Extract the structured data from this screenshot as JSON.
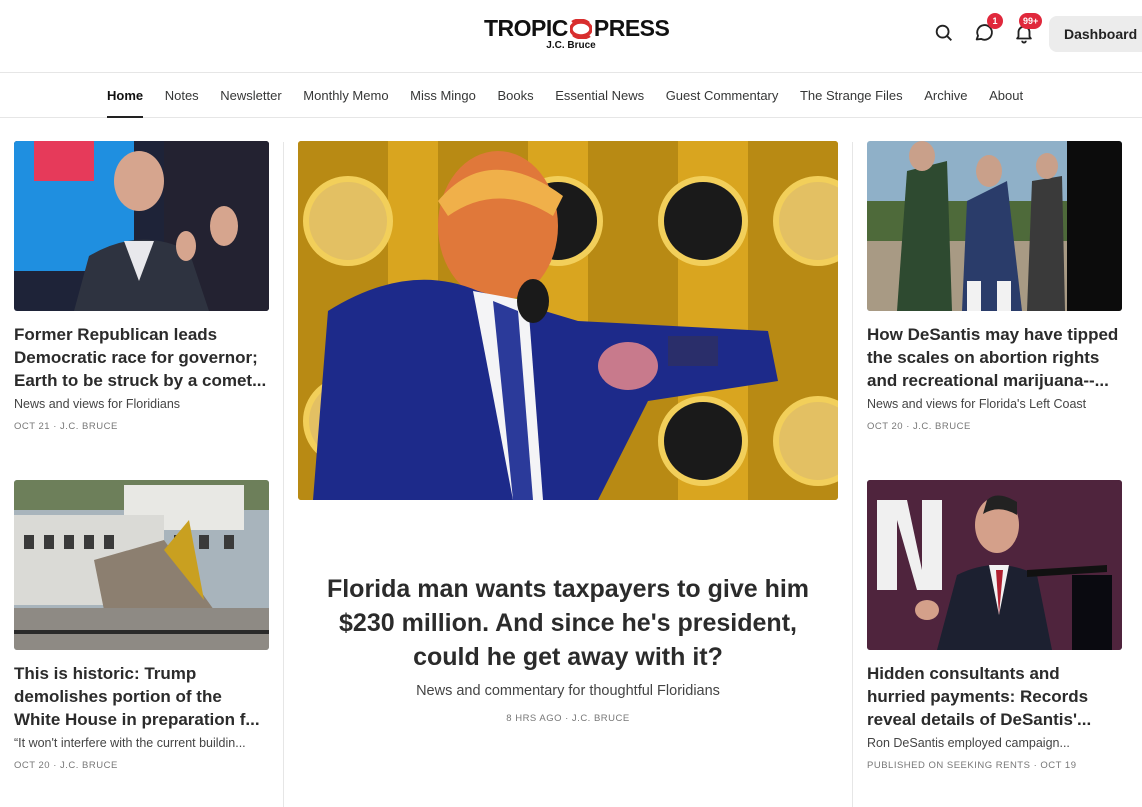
{
  "brand": {
    "name_left": "TROPIC",
    "name_right": "PRESS",
    "author": "J.C. Bruce"
  },
  "header": {
    "search_icon": "search-icon",
    "chat_icon": "chat-bubble-icon",
    "chat_badge": "1",
    "bell_icon": "bell-icon",
    "bell_badge": "99+",
    "dashboard_label": "Dashboard"
  },
  "nav": {
    "items": [
      {
        "label": "Home",
        "active": true
      },
      {
        "label": "Notes"
      },
      {
        "label": "Newsletter"
      },
      {
        "label": "Monthly Memo"
      },
      {
        "label": "Miss Mingo"
      },
      {
        "label": "Books"
      },
      {
        "label": "Essential News"
      },
      {
        "label": "Guest Commentary"
      },
      {
        "label": "The Strange Files"
      },
      {
        "label": "Archive"
      },
      {
        "label": "About"
      }
    ]
  },
  "posts": {
    "left_top": {
      "title": "Former Republican leads Democratic race for governor; Earth to be struck by a comet...",
      "subtitle": "News and views for Floridians",
      "meta": "OCT 21 · J.C. BRUCE"
    },
    "left_bottom": {
      "title": "This is historic: Trump demolishes portion of the White House in preparation f...",
      "subtitle": "“It won't interfere with the current buildin...",
      "meta": "OCT 20 · J.C. BRUCE"
    },
    "featured": {
      "title": "Florida man wants taxpayers to give him $230 million. And since he's president, could he get away with it?",
      "subtitle": "News and commentary for thoughtful Floridians",
      "meta": "8 HRS AGO · J.C. BRUCE"
    },
    "right_top": {
      "title": "How DeSantis may have tipped the scales on abortion rights and recreational marijuana--...",
      "subtitle": "News and views for Florida's Left Coast",
      "meta": "OCT 20 · J.C. BRUCE"
    },
    "right_bottom": {
      "title": "Hidden consultants and hurried payments: Records reveal details of DeSantis'...",
      "subtitle": "Ron DeSantis employed campaign...",
      "meta": "PUBLISHED ON SEEKING RENTS · OCT 19"
    }
  },
  "colors": {
    "accent_red": "#e0283c",
    "logo_mark": "#d82e2e",
    "gold": "#d9a51f",
    "navy": "#1d2a8a"
  }
}
